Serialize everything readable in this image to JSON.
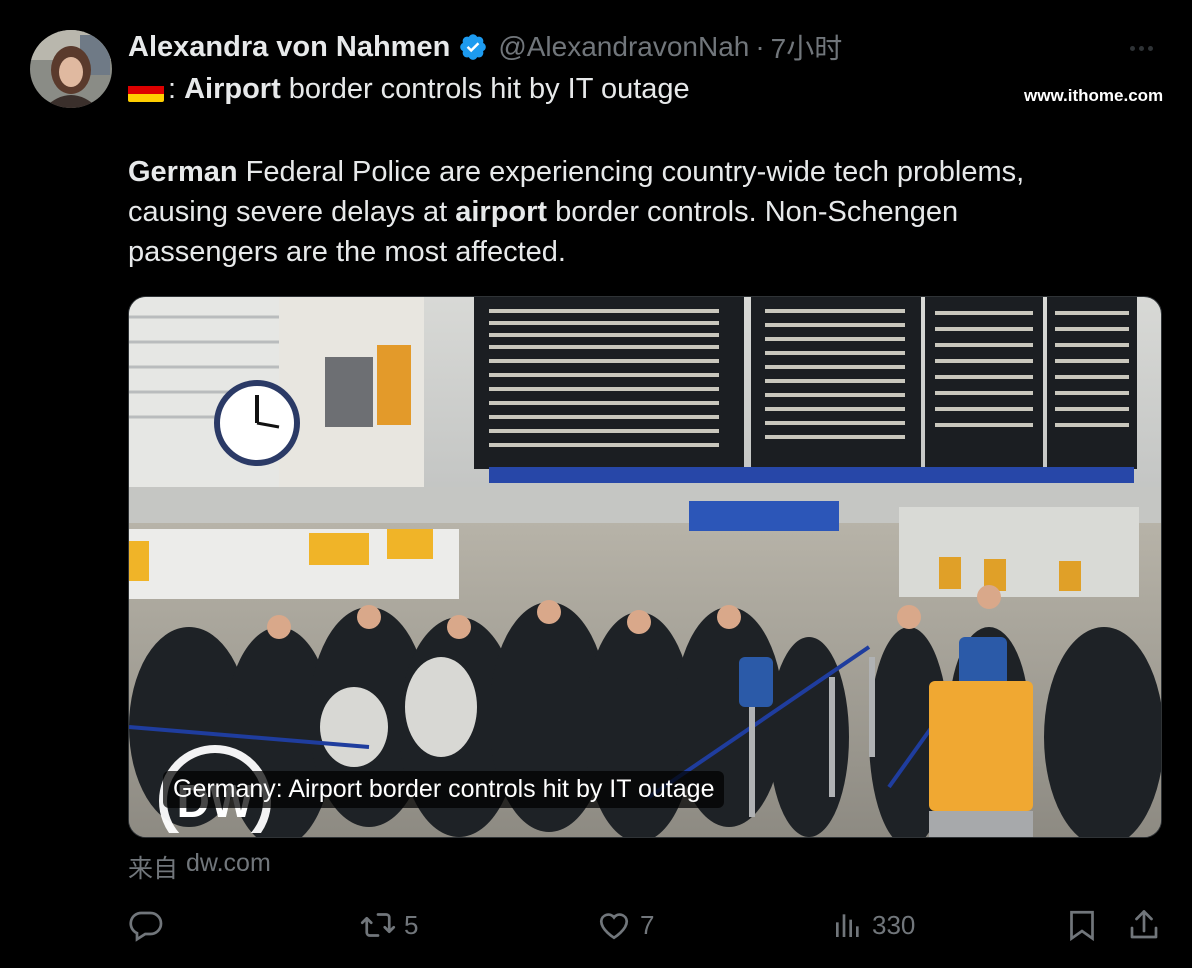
{
  "author": {
    "display_name": "Alexandra von Nahmen",
    "handle": "@AlexandravonNah",
    "separator": "·",
    "time": "7小时",
    "verified_icon": "verified-badge-icon",
    "avatar": "author-avatar"
  },
  "watermark": "www.ithome.com",
  "title": {
    "flag": "germany-flag-icon",
    "prefix": ":",
    "bold_word": "Airport",
    "rest": " border controls hit by IT outage"
  },
  "body": {
    "line1_bold": "German",
    "line1_rest": " Federal Police are experiencing country-wide tech problems,",
    "line2_start": "causing severe delays at ",
    "line2_bold": "airport",
    "line2_rest": " border controls. Non-Schengen",
    "line3": "passengers are the most affected."
  },
  "card": {
    "caption": "Germany: Airport border controls hit by IT outage",
    "logo": "DW"
  },
  "source": {
    "prefix": "来自",
    "domain": "dw.com"
  },
  "actions": {
    "reply": {
      "icon": "reply-icon",
      "count": ""
    },
    "retweet": {
      "icon": "retweet-icon",
      "count": "5"
    },
    "like": {
      "icon": "heart-icon",
      "count": "7"
    },
    "views": {
      "icon": "views-chart-icon",
      "count": "330"
    },
    "bookmark": {
      "icon": "bookmark-icon"
    },
    "share": {
      "icon": "share-icon"
    }
  },
  "colors": {
    "background": "#000000",
    "text": "#e7e9ea",
    "muted": "#71767b",
    "verified": "#1d9bf0"
  }
}
